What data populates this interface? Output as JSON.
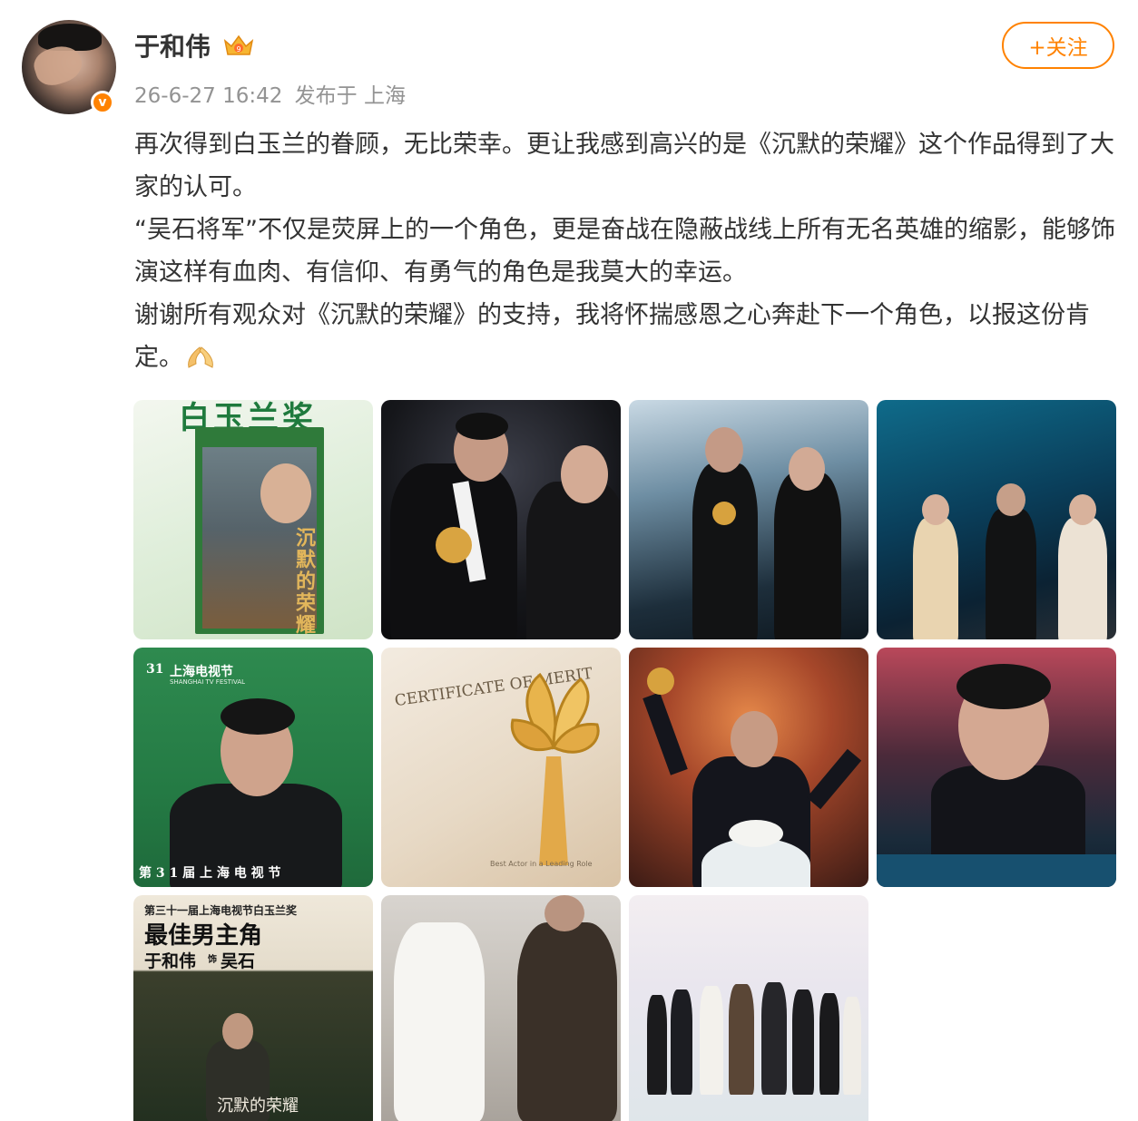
{
  "post": {
    "author": "于和伟",
    "time": "26-6-27 16:42",
    "source": "发布于 上海",
    "follow_label": "+关注",
    "verified_mark": "v",
    "paragraphs": [
      "再次得到白玉兰的眷顾，无比荣幸。更让我感到高兴的是《沉默的荣耀》这个作品得到了大家的认可。",
      "“吴石将军”不仅是荧屏上的一个角色，更是奋战在隐蔽战线上所有无名英雄的缩影，能够饰演这样有血肉、有信仰、有勇气的角色是我莫大的幸运。",
      "谢谢所有观众对《沉默的荣耀》的支持，我将怀揣感恩之心奔赴下一个角色，以报这份肯定。"
    ],
    "trailing_emoji": "praying-hands-emoji"
  },
  "images": {
    "img1": {
      "top_text": "白玉兰奖",
      "poster_title": "沉默的荣耀"
    },
    "img5": {
      "festival": "上海电视节",
      "festival_en": "SHANGHAI TV FESTIVAL",
      "num": "31",
      "footer": "第 3 1 届 上 海 电 视 节"
    },
    "img6": {
      "certificate": "CERTIFICATE OF MERIT",
      "award_en": "Best Actor in a Leading Role"
    },
    "img9": {
      "subtitle": "第三十一届上海电视节白玉兰奖",
      "title": "最佳男主角",
      "name": "于和伟",
      "role_tag": "饰",
      "role": "吴石",
      "drama": "沉默的荣耀"
    }
  },
  "colors": {
    "accent": "#ff8200",
    "meta": "#939393",
    "text": "#333333"
  }
}
